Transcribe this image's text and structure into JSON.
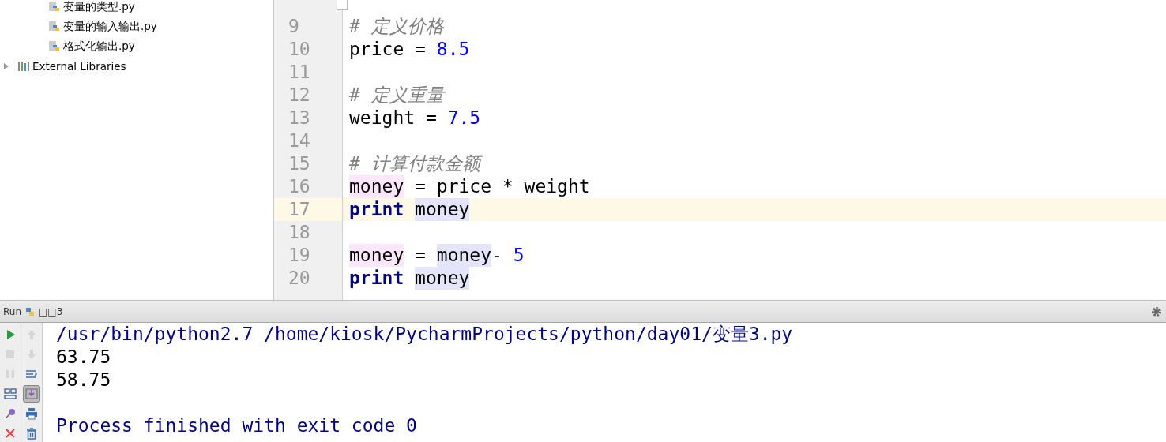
{
  "project_tree": {
    "files": [
      {
        "name": "变量的类型.py"
      },
      {
        "name": "变量的输入输出.py"
      },
      {
        "name": "格式化输出.py"
      }
    ],
    "libraries": {
      "label": "External Libraries",
      "expanded": false
    }
  },
  "editor": {
    "lines": [
      {
        "number": "9",
        "current": false,
        "tokens": [
          {
            "text": "# 定义价格",
            "kind": "comment"
          }
        ]
      },
      {
        "number": "10",
        "current": false,
        "tokens": [
          {
            "text": "price = ",
            "kind": "plain"
          },
          {
            "text": "8.5",
            "kind": "number"
          }
        ]
      },
      {
        "number": "11",
        "current": false
      },
      {
        "number": "12",
        "current": false,
        "tokens": [
          {
            "text": "# 定义重量",
            "kind": "comment"
          }
        ]
      },
      {
        "number": "13",
        "current": false,
        "tokens": [
          {
            "text": "weight = ",
            "kind": "plain"
          },
          {
            "text": "7.5",
            "kind": "number"
          }
        ]
      },
      {
        "number": "14",
        "current": false
      },
      {
        "number": "15",
        "current": false,
        "tokens": [
          {
            "text": "# 计算付款金额",
            "kind": "comment"
          }
        ]
      },
      {
        "number": "16",
        "current": false,
        "tokens": [
          {
            "text": "money",
            "kind": "plain",
            "write": true
          },
          {
            "text": " = price * weight",
            "kind": "plain"
          }
        ]
      },
      {
        "number": "17",
        "current": true,
        "tokens": [
          {
            "text": "print",
            "kind": "keyword"
          },
          {
            "text": "money",
            "kind": "plain",
            "read": true
          }
        ]
      },
      {
        "number": "18",
        "current": false
      },
      {
        "number": "19",
        "current": false,
        "tokens": [
          {
            "text": "money",
            "kind": "plain",
            "write": true
          },
          {
            "text": " = ",
            "kind": "plain"
          },
          {
            "text": "money",
            "kind": "plain",
            "read": true
          },
          {
            "text": "- ",
            "kind": "plain"
          },
          {
            "text": "5",
            "kind": "number"
          }
        ]
      },
      {
        "number": "20",
        "current": false,
        "tokens": [
          {
            "text": "print",
            "kind": "keyword"
          },
          {
            "text": "money",
            "kind": "plain",
            "read": true
          }
        ]
      }
    ]
  },
  "run_panel": {
    "label": "Run",
    "config": "□□3",
    "tools_left": [
      {
        "kind": "run",
        "disabled": false
      },
      {
        "kind": "stop",
        "disabled": true
      },
      {
        "kind": "pause",
        "disabled": true
      },
      {
        "kind": "layout"
      },
      {
        "kind": "pin"
      },
      {
        "kind": "close"
      }
    ],
    "tools_right": [
      {
        "kind": "up",
        "disabled": true
      },
      {
        "kind": "down",
        "disabled": true
      },
      {
        "kind": "wrap"
      },
      {
        "kind": "scroll-end",
        "selected": true
      },
      {
        "kind": "print"
      },
      {
        "kind": "trash"
      }
    ],
    "console": [
      {
        "text": "/usr/bin/python2.7 /home/kiosk/PycharmProjects/python/day01/变量3.py",
        "kind": "system"
      },
      {
        "text": "63.75",
        "kind": "output"
      },
      {
        "text": "58.75",
        "kind": "output"
      },
      {
        "text": "Process finished with exit code 0",
        "kind": "status"
      }
    ]
  }
}
